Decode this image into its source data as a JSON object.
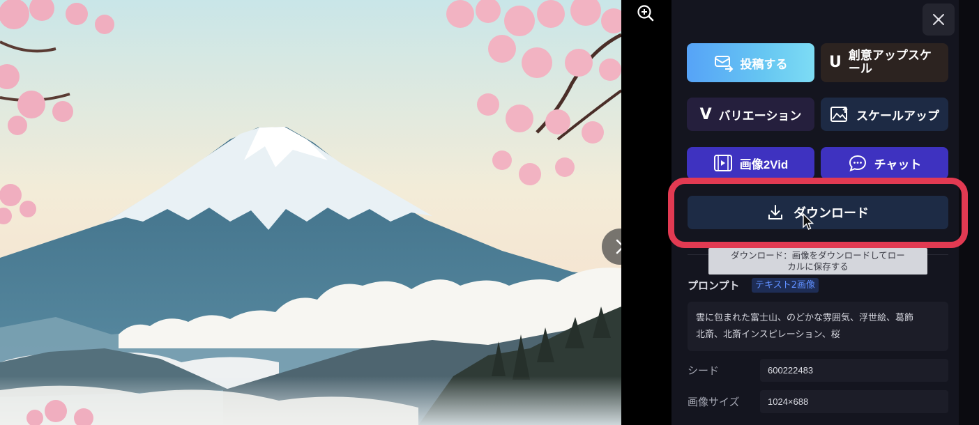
{
  "actions": {
    "post": "投稿する",
    "creative_upscale": "創意アップスケール",
    "creative_upscale_letter": "U",
    "variation": "バリエーション",
    "variation_letter": "V",
    "scale_up": "スケールアップ",
    "img2vid": "画像2Vid",
    "chat": "チャット",
    "download": "ダウンロード"
  },
  "tooltip": {
    "line1": "ダウンロード：画像をダウンロードしてロー",
    "line2": "カルに保存する"
  },
  "prompt": {
    "label": "プロンプト",
    "tag": "テキスト2画像",
    "line1": "雲に包まれた富士山、のどかな雰囲気、浮世絵、葛飾",
    "line2": "北斎、北斎インスピレーション、桜"
  },
  "meta": {
    "seed_label": "シード",
    "seed_value": "600222483",
    "size_label": "画像サイズ",
    "size_value": "1024×688"
  },
  "icons": {
    "zoom": "zoom-in-icon",
    "close": "close-icon",
    "next": "chevron-right-icon",
    "post": "post-icon",
    "scale_up": "image-upscale-icon",
    "img2vid": "video-play-icon",
    "chat": "chat-bubble-icon",
    "download": "download-icon"
  },
  "colors": {
    "panel_bg": "#14151f",
    "post_gradient_start": "#56a3f7",
    "post_gradient_end": "#7ddcf4",
    "purple_button": "#3e32c0",
    "highlight": "#e23a52",
    "tag_text": "#5f8fff"
  }
}
